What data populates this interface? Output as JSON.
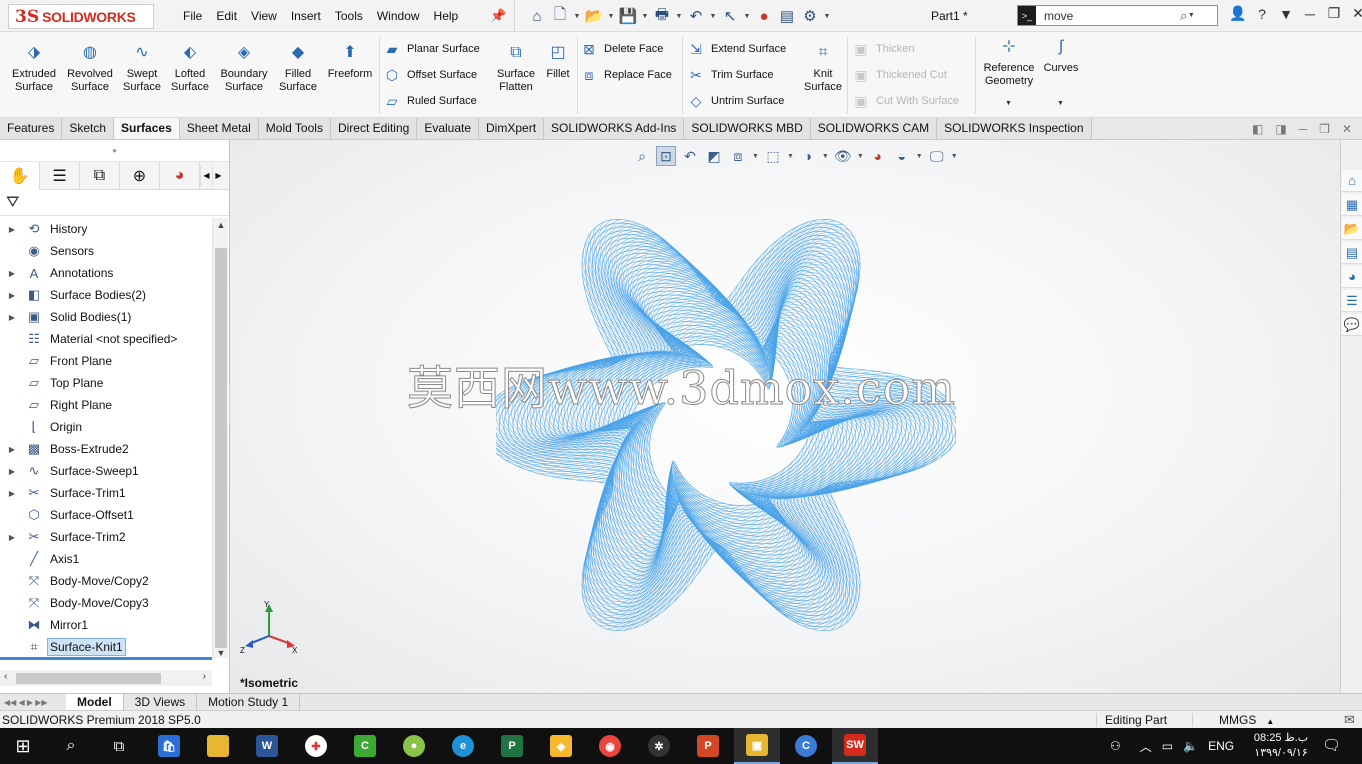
{
  "app": {
    "logo_ds": "3S",
    "logo_name": "SOLIDWORKS",
    "document_title": "Part1 *"
  },
  "menu": [
    "File",
    "Edit",
    "View",
    "Insert",
    "Tools",
    "Window",
    "Help"
  ],
  "search": {
    "value": "move"
  },
  "command_manager": {
    "big_buttons": [
      {
        "label": "Extruded Surface",
        "icon": "extruded-surface-icon"
      },
      {
        "label": "Revolved Surface",
        "icon": "revolved-surface-icon"
      },
      {
        "label": "Swept Surface",
        "icon": "swept-surface-icon"
      },
      {
        "label": "Lofted Surface",
        "icon": "lofted-surface-icon"
      },
      {
        "label": "Boundary Surface",
        "icon": "boundary-surface-icon"
      },
      {
        "label": "Filled Surface",
        "icon": "filled-surface-icon"
      },
      {
        "label": "Freeform",
        "icon": "freeform-icon"
      }
    ],
    "group1": [
      "Planar Surface",
      "Offset Surface",
      "Ruled Surface"
    ],
    "surface_flatten": "Surface Flatten",
    "fillet": "Fillet",
    "group2": [
      "Delete Face",
      "Replace Face"
    ],
    "group3": [
      "Extend Surface",
      "Trim Surface",
      "Untrim Surface"
    ],
    "knit_surface": "Knit Surface",
    "group4_disabled": [
      "Thicken",
      "Thickened Cut",
      "Cut With Surface"
    ],
    "reference_geometry": "Reference Geometry",
    "curves": "Curves"
  },
  "tabs": [
    {
      "label": "Features",
      "active": false
    },
    {
      "label": "Sketch",
      "active": false
    },
    {
      "label": "Surfaces",
      "active": true
    },
    {
      "label": "Sheet Metal",
      "active": false
    },
    {
      "label": "Mold Tools",
      "active": false
    },
    {
      "label": "Direct Editing",
      "active": false
    },
    {
      "label": "Evaluate",
      "active": false
    },
    {
      "label": "DimXpert",
      "active": false
    },
    {
      "label": "SOLIDWORKS Add-Ins",
      "active": false
    },
    {
      "label": "SOLIDWORKS MBD",
      "active": false
    },
    {
      "label": "SOLIDWORKS CAM",
      "active": false
    },
    {
      "label": "SOLIDWORKS Inspection",
      "active": false
    }
  ],
  "feature_tree": [
    {
      "label": "History",
      "expandable": true,
      "icon": "history-icon"
    },
    {
      "label": "Sensors",
      "expandable": false,
      "icon": "sensors-icon"
    },
    {
      "label": "Annotations",
      "expandable": true,
      "icon": "annotations-icon"
    },
    {
      "label": "Surface Bodies(2)",
      "expandable": true,
      "icon": "surface-bodies-icon"
    },
    {
      "label": "Solid Bodies(1)",
      "expandable": true,
      "icon": "solid-bodies-icon"
    },
    {
      "label": "Material <not specified>",
      "expandable": false,
      "icon": "material-icon"
    },
    {
      "label": "Front Plane",
      "expandable": false,
      "icon": "plane-icon"
    },
    {
      "label": "Top Plane",
      "expandable": false,
      "icon": "plane-icon"
    },
    {
      "label": "Right Plane",
      "expandable": false,
      "icon": "plane-icon"
    },
    {
      "label": "Origin",
      "expandable": false,
      "icon": "origin-icon"
    },
    {
      "label": "Boss-Extrude2",
      "expandable": true,
      "icon": "boss-extrude-icon"
    },
    {
      "label": "Surface-Sweep1",
      "expandable": true,
      "icon": "surface-sweep-icon"
    },
    {
      "label": "Surface-Trim1",
      "expandable": true,
      "icon": "surface-trim-icon"
    },
    {
      "label": "Surface-Offset1",
      "expandable": false,
      "icon": "surface-offset-icon"
    },
    {
      "label": "Surface-Trim2",
      "expandable": true,
      "icon": "surface-trim-icon"
    },
    {
      "label": "Axis1",
      "expandable": false,
      "icon": "axis-icon"
    },
    {
      "label": "Body-Move/Copy2",
      "expandable": false,
      "icon": "body-move-icon"
    },
    {
      "label": "Body-Move/Copy3",
      "expandable": false,
      "icon": "body-move-icon"
    },
    {
      "label": "Mirror1",
      "expandable": false,
      "icon": "mirror-icon"
    },
    {
      "label": "Surface-Knit1",
      "expandable": false,
      "icon": "surface-knit-icon",
      "selected": true
    }
  ],
  "viewport": {
    "watermark": "莫西网www.3dmox.com",
    "view_label": "*Isometric",
    "triad": {
      "x": "X",
      "y": "Y",
      "z": "Z"
    },
    "model_color": "#4aa3e8"
  },
  "bottom_tabs": [
    {
      "label": "Model",
      "active": true
    },
    {
      "label": "3D Views",
      "active": false
    },
    {
      "label": "Motion Study 1",
      "active": false
    }
  ],
  "status": {
    "version": "SOLIDWORKS Premium 2018 SP5.0",
    "mode": "Editing Part",
    "units": "MMGS"
  },
  "taskbar": {
    "language": "ENG",
    "time": "08:25 ب.ظ",
    "date": "۱۳۹۹/۰۹/۱۶"
  },
  "colors": {
    "brand_red": "#d52b1e",
    "accent_blue": "#2b6cb0",
    "selection": "#cfe3f6"
  }
}
